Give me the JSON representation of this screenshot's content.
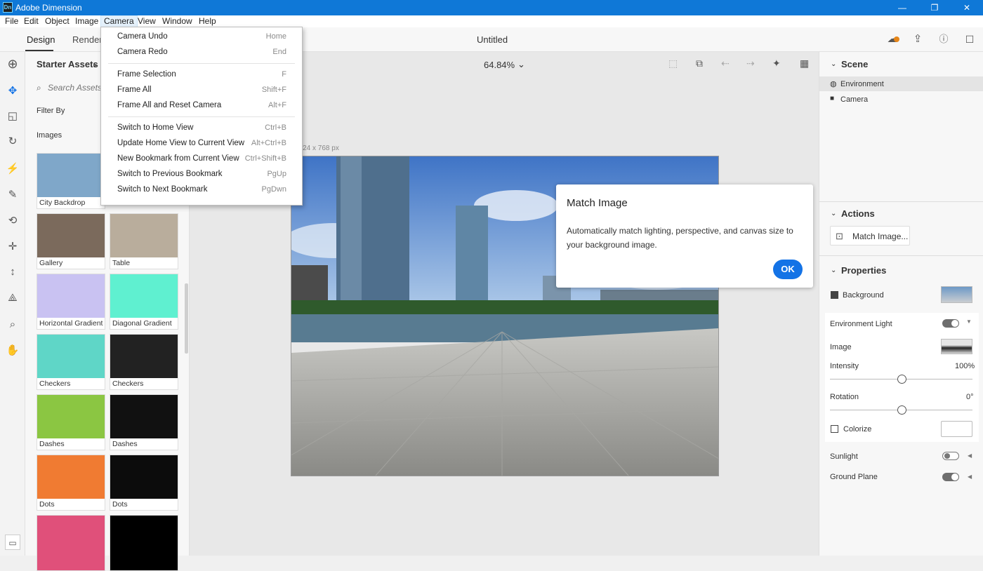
{
  "app": {
    "title": "Adobe Dimension",
    "logo_text": "Dn"
  },
  "window_controls": {
    "minimize": "—",
    "restore": "❐",
    "close": "✕"
  },
  "menubar": [
    "File",
    "Edit",
    "Object",
    "Image",
    "Camera",
    "View",
    "Window",
    "Help"
  ],
  "topbar": {
    "tabs": [
      "Design",
      "Render"
    ],
    "doc_title": "Untitled"
  },
  "zoom": {
    "value": "64.84%"
  },
  "canvas": {
    "size_label": "1024 x 768 px"
  },
  "assets": {
    "title": "Starter Assets",
    "search_placeholder": "Search Assets...",
    "filter_by": "Filter By",
    "section": "Images",
    "items": [
      {
        "label": "City Backdrop",
        "color": "#7fa7c9"
      },
      {
        "label": "Gallery",
        "color": "#7b6a5c"
      },
      {
        "label": "Table",
        "color": "#b9ad9c"
      },
      {
        "label": "Horizontal Gradient",
        "color": "#c9c2f2"
      },
      {
        "label": "Diagonal Gradient",
        "color": "#5ff0d0"
      },
      {
        "label": "Checkers",
        "color": "#5fd6c7"
      },
      {
        "label": "Checkers",
        "color": "#222222"
      },
      {
        "label": "Dashes",
        "color": "#8bc642"
      },
      {
        "label": "Dashes",
        "color": "#111111"
      },
      {
        "label": "Dots",
        "color": "#f07b32"
      },
      {
        "label": "Dots",
        "color": "#0c0c0c"
      }
    ]
  },
  "camera_menu": [
    {
      "label": "Camera Undo",
      "shortcut": "Home"
    },
    {
      "label": "Camera Redo",
      "shortcut": "End"
    },
    {
      "label": "Frame Selection",
      "shortcut": "F"
    },
    {
      "label": "Frame All",
      "shortcut": "Shift+F"
    },
    {
      "label": "Frame All and Reset Camera",
      "shortcut": "Alt+F"
    },
    {
      "label": "Switch to Home View",
      "shortcut": "Ctrl+B"
    },
    {
      "label": "Update Home View to Current View",
      "shortcut": "Alt+Ctrl+B"
    },
    {
      "label": "New Bookmark from Current View",
      "shortcut": "Ctrl+Shift+B"
    },
    {
      "label": "Switch to Previous Bookmark",
      "shortcut": "PgUp"
    },
    {
      "label": "Switch to Next Bookmark",
      "shortcut": "PgDwn"
    }
  ],
  "dialog": {
    "title": "Match Image",
    "body": "Automatically match lighting, perspective, and canvas size to your background image.",
    "ok": "OK"
  },
  "scene": {
    "title": "Scene",
    "items": [
      "Environment",
      "Camera"
    ],
    "actions_title": "Actions",
    "match_image_btn": "Match Image...",
    "properties_title": "Properties",
    "background": "Background",
    "env_light": "Environment Light",
    "image": "Image",
    "intensity": {
      "label": "Intensity",
      "value": "100%",
      "level": 0.5
    },
    "rotation": {
      "label": "Rotation",
      "value": "0°",
      "level": 0.5
    },
    "colorize": "Colorize",
    "sunlight": "Sunlight",
    "ground_plane": "Ground Plane"
  },
  "colors": {
    "accent": "#1473e6",
    "titlebar": "#0f78d7"
  }
}
